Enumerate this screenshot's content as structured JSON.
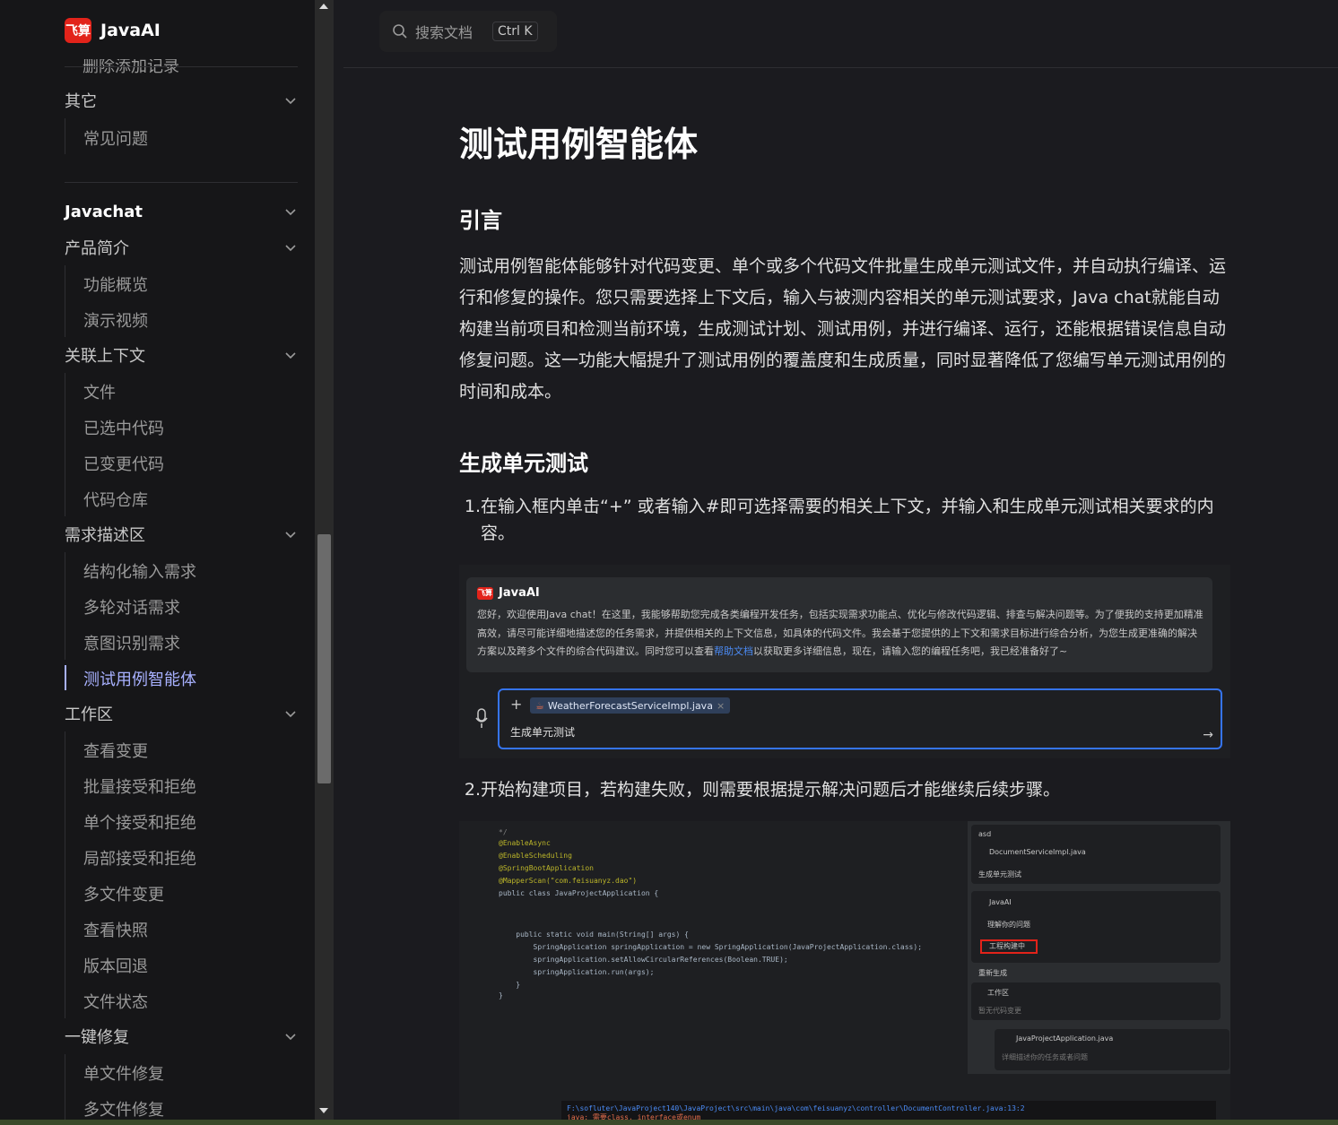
{
  "app": {
    "name": "JavaAI",
    "logo_text": "飞算"
  },
  "sidebar": {
    "cut_item": "删除添加记录",
    "group_other": "其它",
    "faq": "常见问题",
    "section": "Javachat",
    "groups": [
      {
        "label": "产品简介",
        "items": [
          "功能概览",
          "演示视频"
        ]
      },
      {
        "label": "关联上下文",
        "items": [
          "文件",
          "已选中代码",
          "已变更代码",
          "代码仓库"
        ]
      },
      {
        "label": "需求描述区",
        "items": [
          "结构化输入需求",
          "多轮对话需求",
          "意图识别需求",
          "测试用例智能体"
        ]
      },
      {
        "label": "工作区",
        "items": [
          "查看变更",
          "批量接受和拒绝",
          "单个接受和拒绝",
          "局部接受和拒绝",
          "多文件变更",
          "查看快照",
          "版本回退",
          "文件状态"
        ]
      },
      {
        "label": "一键修复",
        "items": [
          "单文件修复",
          "多文件修复"
        ]
      }
    ],
    "active_item": "测试用例智能体"
  },
  "search": {
    "placeholder": "搜索文档",
    "shortcut": "Ctrl K"
  },
  "article": {
    "title": "测试用例智能体",
    "intro_heading": "引言",
    "intro_text": "测试用例智能体能够针对代码变更、单个或多个代码文件批量生成单元测试文件，并自动执行编译、运行和修复的操作。您只需要选择上下文后，输入与被测内容相关的单元测试要求，Java chat就能自动构建当前项目和检测当前环境，生成测试计划、测试用例，并进行编译、运行，还能根据错误信息自动修复问题。这一功能大幅提升了测试用例的覆盖度和生成质量，同时显著降低了您编写单元测试用例的时间和成本。",
    "gen_heading": "生成单元测试",
    "step1": "在输入框内单击“+” 或者输入#即可选择需要的相关上下文，并输入和生成单元测试相关要求的内容。",
    "step2": "开始构建项目，若构建失败，则需要根据提示解决问题后才能继续后续步骤。"
  },
  "screenshot1": {
    "title": "JavaAI",
    "badge": "飞算",
    "greeting_pre": "您好，欢迎使用Java chat！在这里，我能够帮助您完成各类编程开发任务，包括实现需求功能点、优化与修改代码逻辑、排查与解决问题等。为了便我的支持更加精准高效，请尽可能详细地描述您的任务需求，并提供相关的上下文信息，如具体的代码文件。我会基于您提供的上下文和需求目标进行综合分析，为您生成更准确的解决方案以及跨多个文件的综合代码建议。同时您可以查看",
    "greeting_link": "帮助文档",
    "greeting_post": "以获取更多详细信息，现在，请输入您的编程任务吧，我已经准备好了~",
    "chip_file": "WeatherForecastServiceImpl.java",
    "input_text": "生成单元测试"
  },
  "screenshot2": {
    "code_lines": [
      "*/",
      "@EnableAsync",
      "@EnableScheduling",
      "@SpringBootApplication",
      "@MapperScan(\"com.feisuanyz.dao\")",
      "public class JavaProjectApplication {",
      "",
      "",
      "    public static void main(String[] args) {",
      "        SpringApplication springApplication = new SpringApplication(JavaProjectApplication.class);",
      "        springApplication.setAllowCircularReferences(Boolean.TRUE);",
      "        springApplication.run(args);",
      "    }",
      "}"
    ],
    "user": "asd",
    "file": "DocumentServiceImpl.java",
    "request": "生成单元测试",
    "ai_name": "JavaAI",
    "understood": "理解你的问题",
    "building": "工程构建中",
    "regenerate": "重新生成",
    "workspace": "工作区",
    "workspace_empty": "暂无代码变更",
    "chip2": "JavaProjectApplication.java",
    "input_placeholder": "详细描述你的任务或者问题",
    "path": "F:\\sofluter\\JavaProject140\\JavaProject\\src\\main\\java\\com\\feisuanyz\\controller\\DocumentController.java:13:2",
    "path2": "java: 需要class, interface或enum"
  }
}
